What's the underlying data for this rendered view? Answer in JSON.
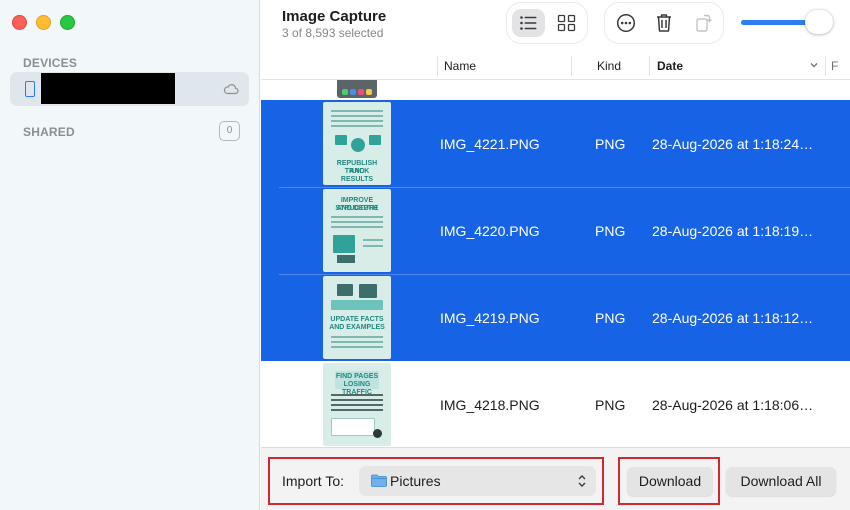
{
  "window": {
    "title": "Image Capture",
    "subtitle": "3 of 8,593 selected"
  },
  "sidebar": {
    "devices_heading": "DEVICES",
    "shared_heading": "SHARED",
    "shared_count": "0"
  },
  "toolbar": {
    "view_modes": [
      "list-view",
      "grid-view"
    ],
    "active_view": "list-view",
    "thumbnail_size_level": 0.85
  },
  "table": {
    "columns": {
      "name": "Name",
      "kind": "Kind",
      "date": "Date"
    },
    "rows": [
      {
        "name": "IMG_4221.PNG",
        "kind": "PNG",
        "date": "28-Aug-2026 at 1:18:24…",
        "selected": true,
        "thumb_lines": [
          "Update the content date,",
          "republish the page, and",
          "monitor rankings, traffic,",
          "and reader behavior."
        ],
        "thumb_title": [
          "REPUBLISH AND",
          "TRACK RESULTS"
        ]
      },
      {
        "name": "IMG_4220.PNG",
        "kind": "PNG",
        "date": "28-Aug-2026 at 1:18:19…",
        "selected": true,
        "thumb_title": [
          "IMPROVE STRUCTURE",
          "AND DEPTH"
        ]
      },
      {
        "name": "IMG_4219.PNG",
        "kind": "PNG",
        "date": "28-Aug-2026 at 1:18:12…",
        "selected": true,
        "thumb_title": [
          "UPDATE FACTS",
          "AND EXAMPLES"
        ]
      },
      {
        "name": "IMG_4218.PNG",
        "kind": "PNG",
        "date": "28-Aug-2026 at 1:18:06…",
        "selected": false,
        "thumb_title": [
          "FIND PAGES",
          "LOSING TRAFFIC"
        ]
      }
    ]
  },
  "bottom": {
    "import_label": "Import To:",
    "import_destination": "Pictures",
    "download_label": "Download",
    "download_all_label": "Download All"
  },
  "colors": {
    "selection": "#1763e6",
    "accent": "#2f7cf6",
    "highlight_box": "#d0282e",
    "thumbnail_teal": "#2fa39a"
  }
}
